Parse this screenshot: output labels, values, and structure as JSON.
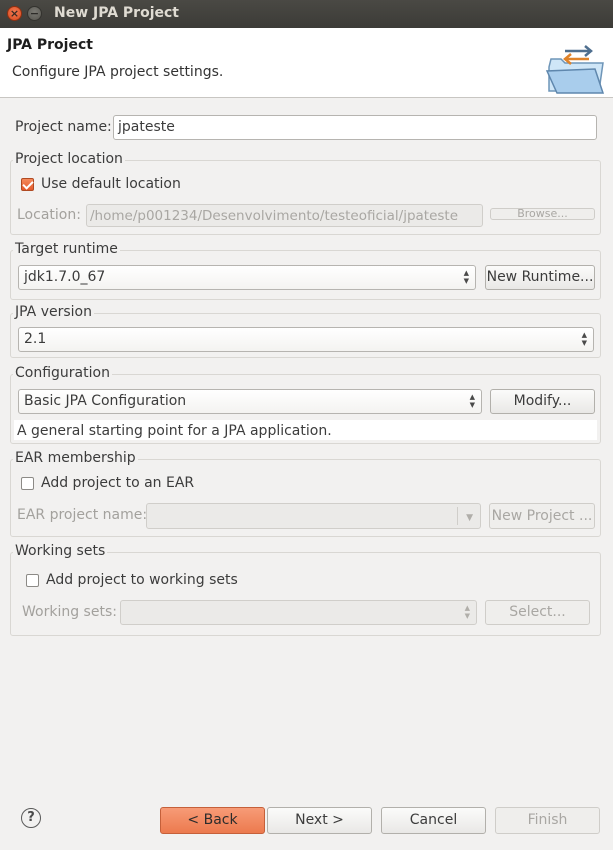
{
  "window": {
    "title": "New JPA Project",
    "close_glyph": "×",
    "minimize_glyph": "−"
  },
  "header": {
    "title": "JPA Project",
    "description": "Configure JPA project settings.",
    "icon": "folder-swap-icon"
  },
  "project_name": {
    "label": "Project name:",
    "value": "jpateste"
  },
  "project_location": {
    "group_title": "Project location",
    "use_default_label": "Use default location",
    "use_default_checked": true,
    "location_label": "Location:",
    "location_value": "/home/p001234/Desenvolvimento/testeoficial/jpateste",
    "browse_label": "Browse..."
  },
  "target_runtime": {
    "group_title": "Target runtime",
    "selected": "jdk1.7.0_67",
    "new_runtime_label": "New Runtime..."
  },
  "jpa_version": {
    "group_title": "JPA version",
    "selected": "2.1"
  },
  "configuration": {
    "group_title": "Configuration",
    "selected": "Basic JPA Configuration",
    "modify_label": "Modify...",
    "description": "A general starting point for a JPA application."
  },
  "ear_membership": {
    "group_title": "EAR membership",
    "add_label": "Add project to an EAR",
    "add_checked": false,
    "ear_name_label": "EAR project name:",
    "ear_name_value": "",
    "new_project_label": "New Project ..."
  },
  "working_sets": {
    "group_title": "Working sets",
    "add_label": "Add project to working sets",
    "add_checked": false,
    "sets_label": "Working sets:",
    "sets_value": "",
    "select_label": "Select..."
  },
  "footer": {
    "help_glyph": "?",
    "back_label": "< Back",
    "next_label": "Next >",
    "cancel_label": "Cancel",
    "finish_label": "Finish"
  },
  "colors": {
    "accent": "#ec7a4e",
    "titlebar": "#3c3b37",
    "dialog_bg": "#f2f1f0"
  }
}
